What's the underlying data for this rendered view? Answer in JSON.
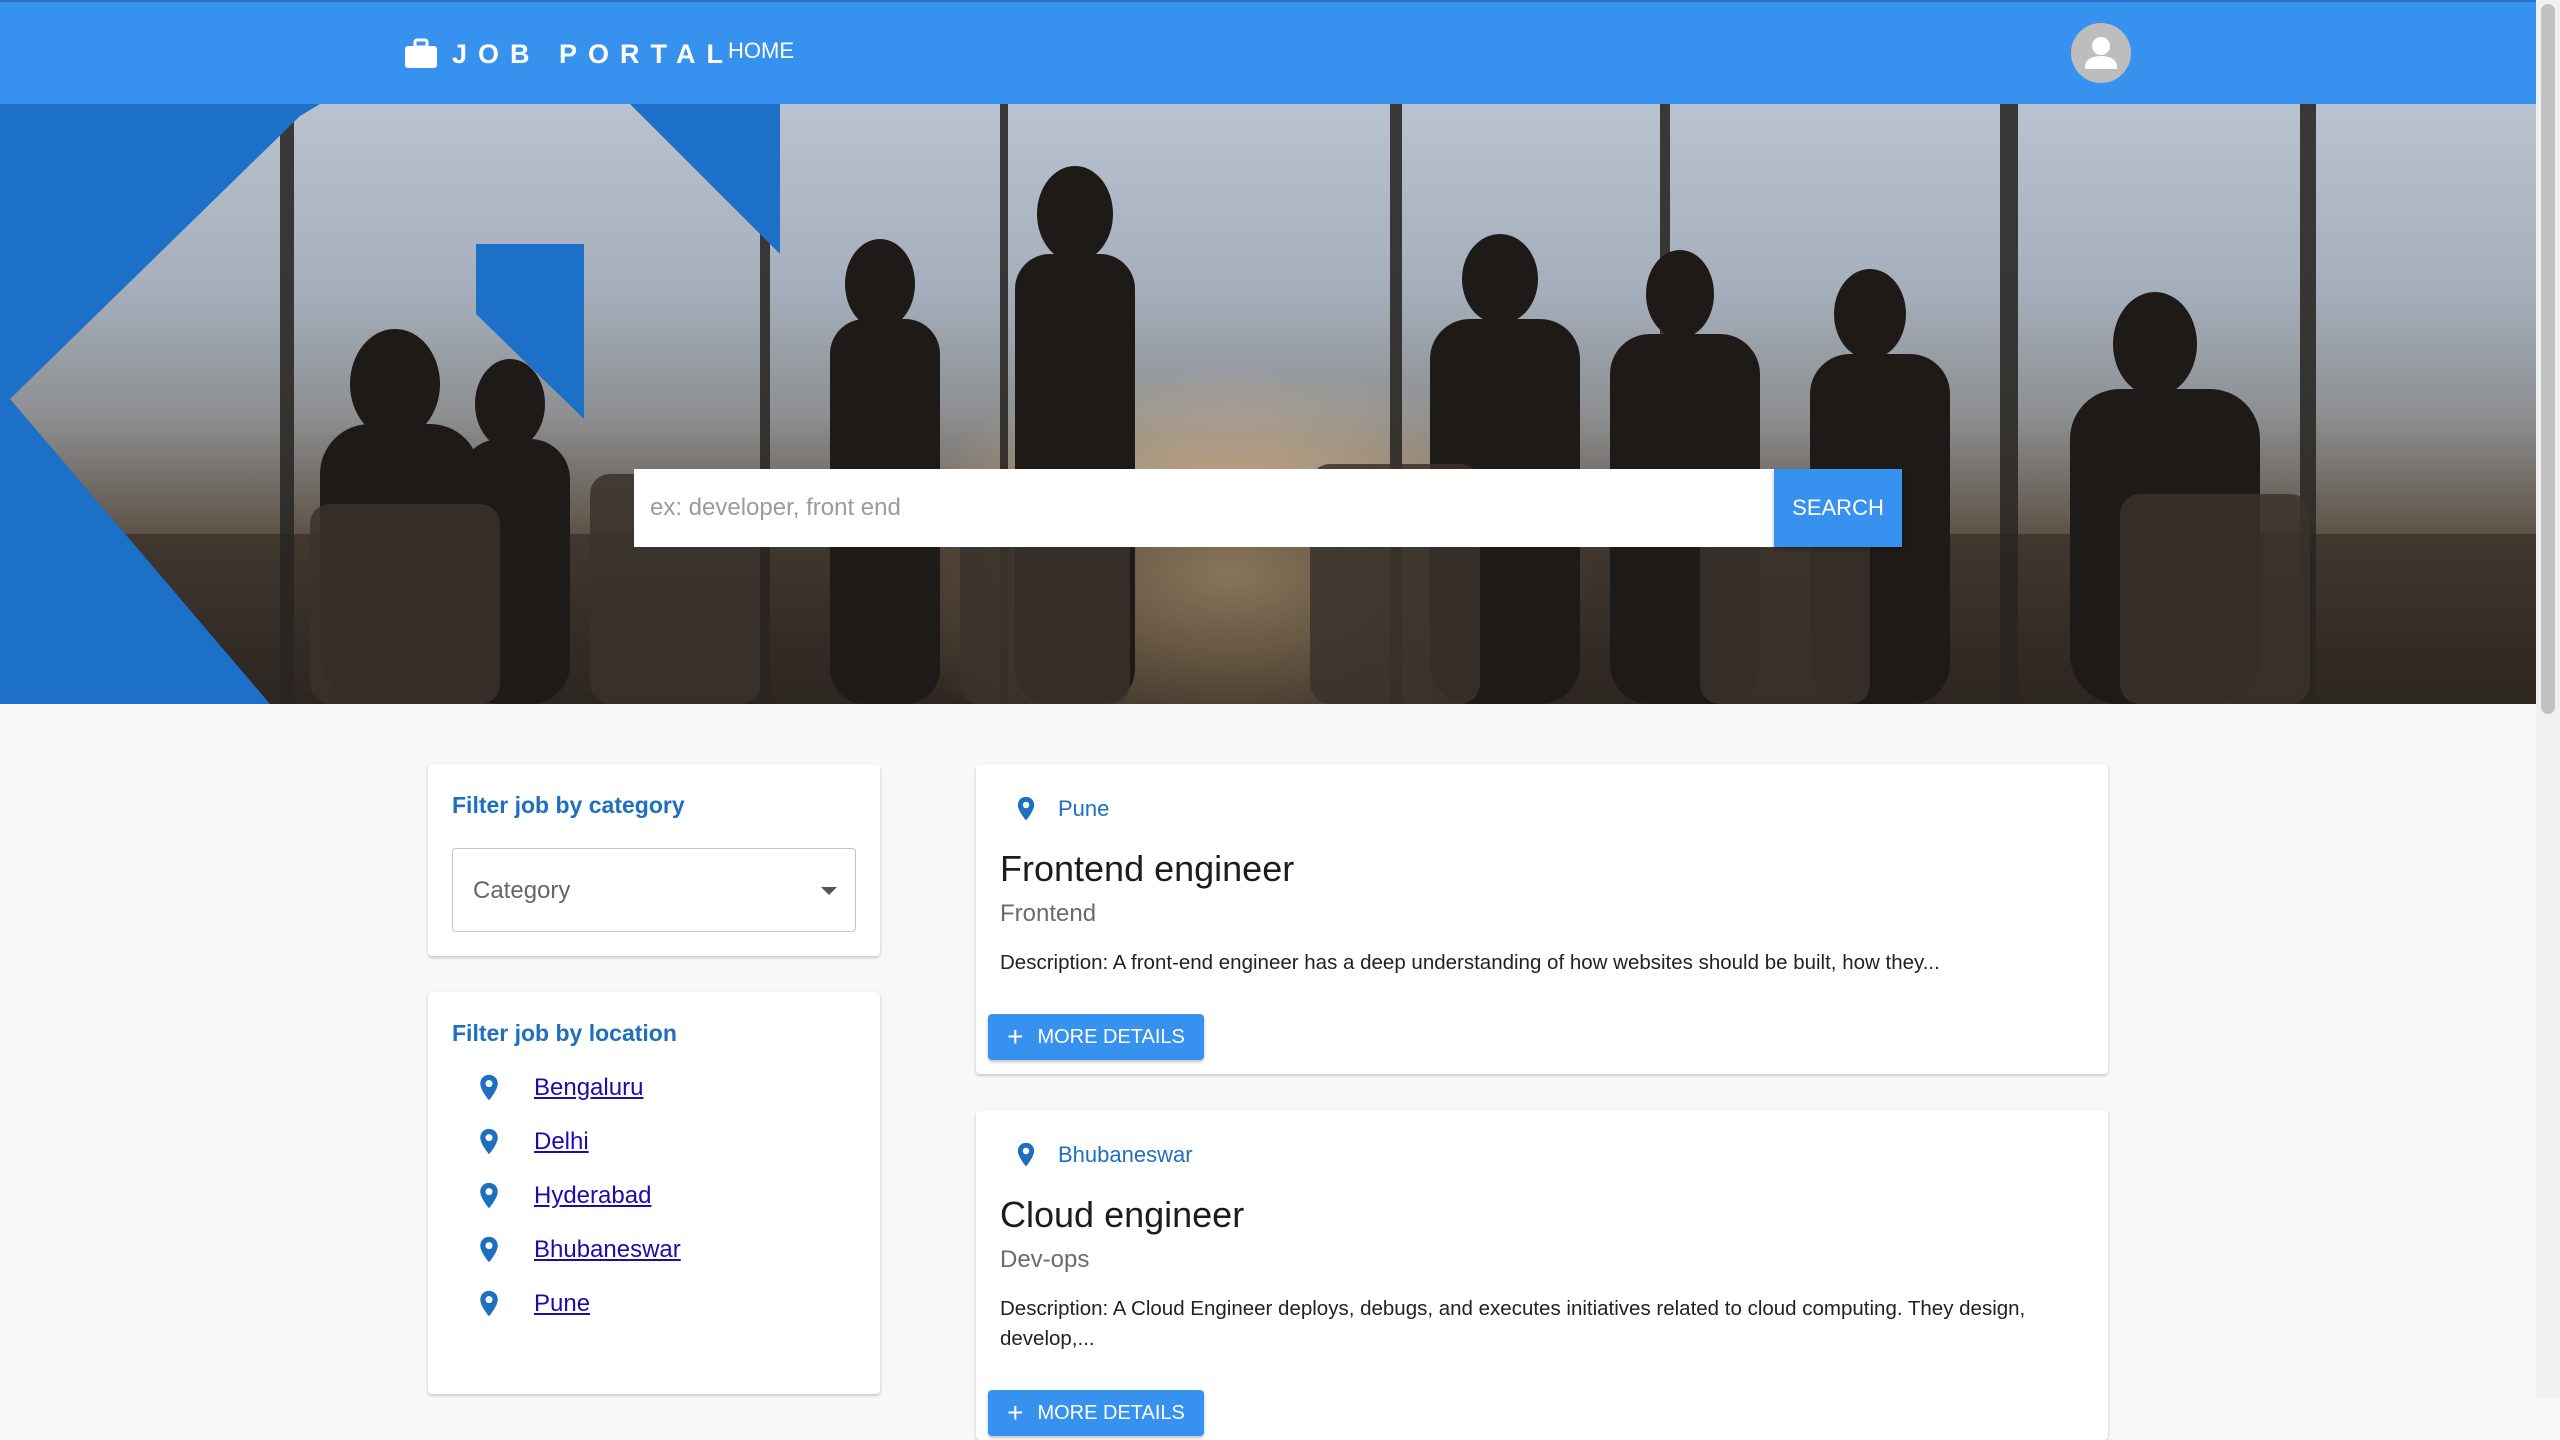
{
  "header": {
    "brand": "JOB PORTAL",
    "nav": {
      "home": "HOME"
    }
  },
  "search": {
    "placeholder": "ex: developer, front end",
    "button": "SEARCH"
  },
  "filters": {
    "category": {
      "title": "Filter job by category",
      "select_label": "Category"
    },
    "location": {
      "title": "Filter job by location",
      "items": [
        "Bengaluru",
        "Delhi",
        "Hyderabad",
        "Bhubaneswar",
        "Pune"
      ]
    }
  },
  "jobs": [
    {
      "location": "Pune",
      "title": "Frontend engineer",
      "category": "Frontend",
      "description": "Description: A front-end engineer has a deep understanding of how websites should be built, how they...",
      "button": "MORE DETAILS"
    },
    {
      "location": "Bhubaneswar",
      "title": "Cloud engineer",
      "category": "Dev-ops",
      "description": "Description: A Cloud Engineer deploys, debugs, and executes initiatives related to cloud computing. They design, develop,...",
      "button": "MORE DETAILS"
    }
  ],
  "colors": {
    "primary": "#3791ee",
    "accent_text": "#1f6fc0",
    "link": "#1a0dab",
    "page_background": "#f8f8f8"
  }
}
